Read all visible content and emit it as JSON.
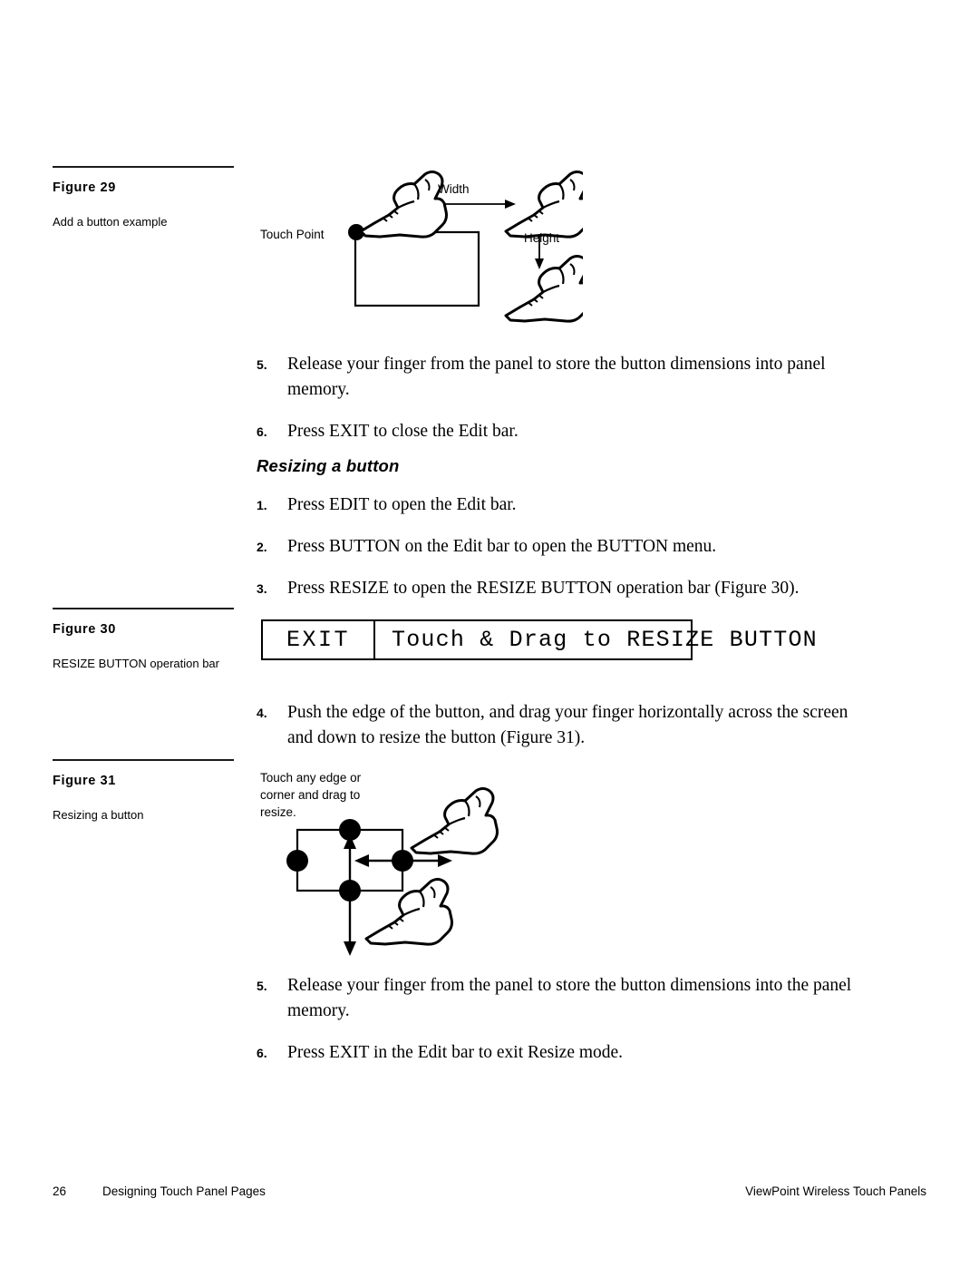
{
  "document": {
    "page_number": "26",
    "footer_left": "Designing Touch Panel Pages",
    "footer_right": "ViewPoint Wireless Touch Panels"
  },
  "figure29": {
    "title": "Figure 29",
    "caption": "Add a button example",
    "diagram": {
      "touch_point_label": "Touch Point",
      "width_label": "Width",
      "height_label": "Height",
      "hand_icon": "pointing-hand-icon"
    }
  },
  "steps_add_button": [
    {
      "number": "5.",
      "text": "Release your finger from the panel to store the button dimensions into panel memory."
    },
    {
      "number": "6.",
      "text": "Press EXIT to close the Edit bar."
    }
  ],
  "section": {
    "heading": "Resizing a button"
  },
  "steps_resize_start": [
    {
      "number": "1.",
      "text": "Press EDIT to open the Edit bar."
    },
    {
      "number": "2.",
      "text": "Press BUTTON on the Edit bar to open the BUTTON menu."
    },
    {
      "number": "3.",
      "text": "Press RESIZE to open the RESIZE BUTTON operation bar (Figure 30)."
    }
  ],
  "figure30": {
    "title": "Figure 30",
    "caption": "RESIZE BUTTON operation bar",
    "operation_bar": {
      "exit_label": "EXIT",
      "message": "Touch & Drag to RESIZE BUTTON"
    }
  },
  "steps_resize_mid": [
    {
      "number": "4.",
      "text": "Push the edge of the button, and drag your finger horizontally across the screen and down to resize the button (Figure 31)."
    }
  ],
  "figure31": {
    "title": "Figure 31",
    "caption": "Resizing a button",
    "diagram": {
      "instruction": "Touch any edge or corner and drag to resize.",
      "hand_icon": "pointing-hand-icon"
    }
  },
  "steps_resize_end": [
    {
      "number": "5.",
      "text": "Release your finger from the panel to store the button dimensions into the panel memory."
    },
    {
      "number": "6.",
      "text": "Press EXIT in the Edit bar to exit Resize mode."
    }
  ],
  "colors": {
    "ink": "#000000",
    "paper": "#ffffff",
    "rule": "#1a1a1a"
  }
}
